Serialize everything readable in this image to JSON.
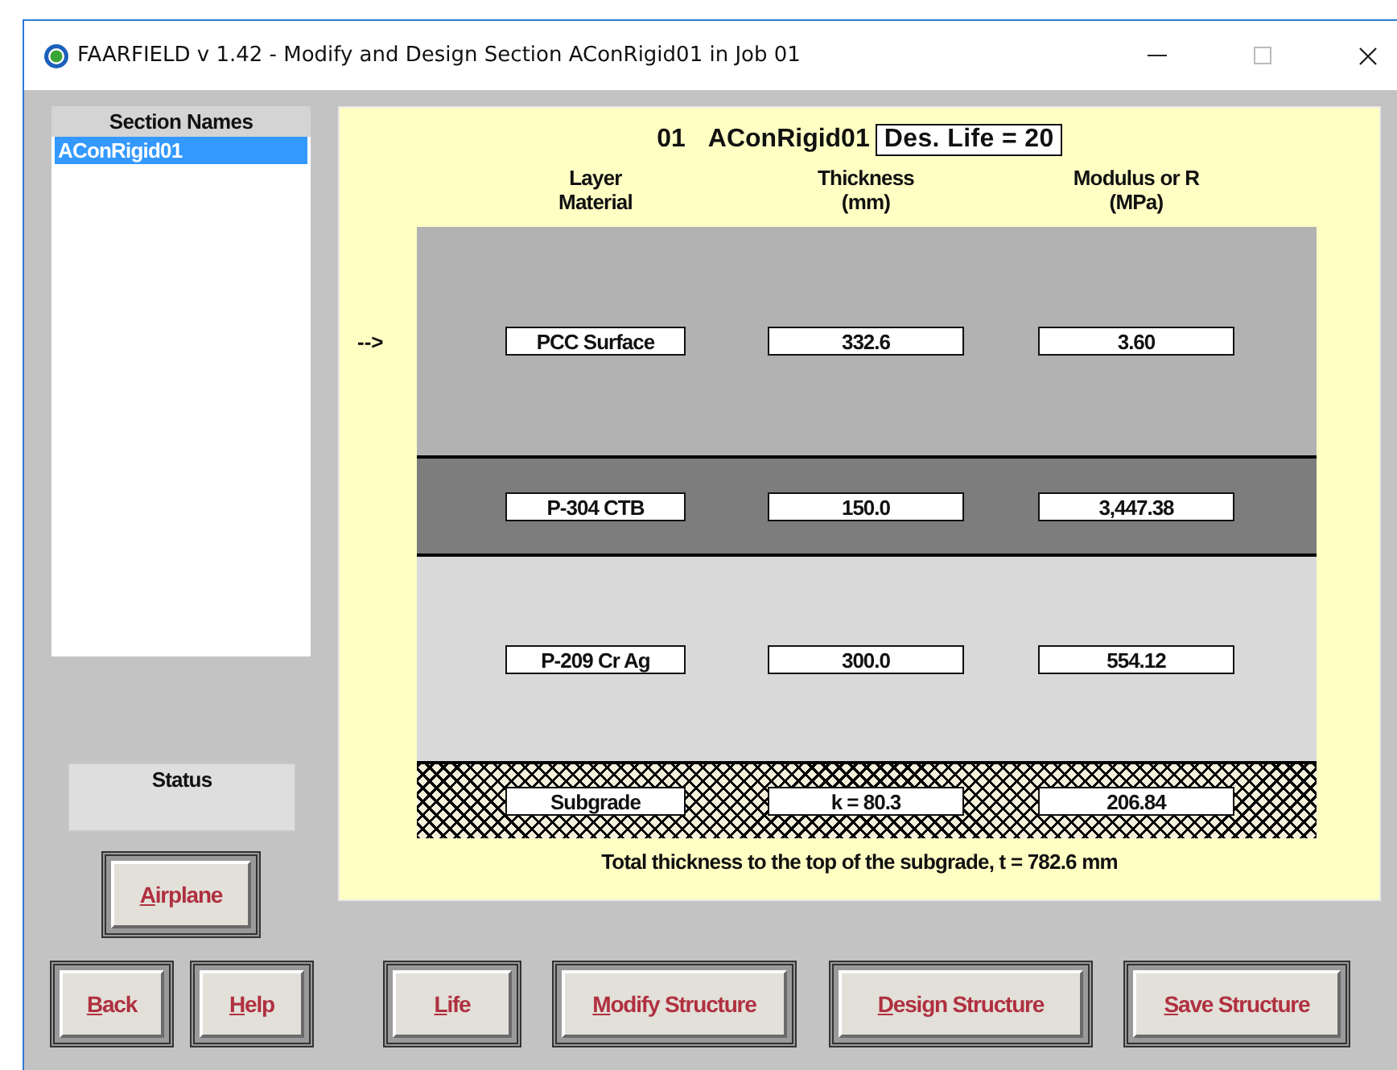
{
  "window": {
    "title": "FAARFIELD v 1.42 - Modify and Design Section AConRigid01 in Job 01"
  },
  "sections": {
    "header": "Section Names",
    "items": [
      {
        "label": "AConRigid01",
        "selected": true
      }
    ]
  },
  "status": {
    "label": "Status"
  },
  "structure": {
    "number": "01",
    "name": "AConRigid01",
    "design_life": "Des. Life = 20",
    "columns": [
      [
        "Layer",
        "Material"
      ],
      [
        "Thickness",
        "(mm)"
      ],
      [
        "Modulus or R",
        "(MPa)"
      ]
    ],
    "layers": [
      {
        "kind": "surface",
        "pointer": "-->",
        "material": "PCC Surface",
        "thickness": "332.6",
        "modulus": "3.60"
      },
      {
        "kind": "base",
        "material": "P-304 CTB",
        "thickness": "150.0",
        "modulus": "3,447.38"
      },
      {
        "kind": "subbase",
        "material": "P-209 Cr Ag",
        "thickness": "300.0",
        "modulus": "554.12"
      },
      {
        "kind": "subgrade",
        "material": "Subgrade",
        "thickness": "k = 80.3",
        "modulus": "206.84"
      }
    ],
    "total": "Total thickness to the top of the subgrade, t = 782.6 mm"
  },
  "side_button": "Airplane",
  "buttons": [
    {
      "label": "Back",
      "kind": "small"
    },
    {
      "label": "Help",
      "kind": "small"
    },
    {
      "label": "Life",
      "kind": "medium"
    },
    {
      "label": "Modify Structure",
      "kind": "wide"
    },
    {
      "label": "Design Structure",
      "kind": "wide"
    },
    {
      "label": "Save Structure",
      "kind": "wide"
    }
  ]
}
